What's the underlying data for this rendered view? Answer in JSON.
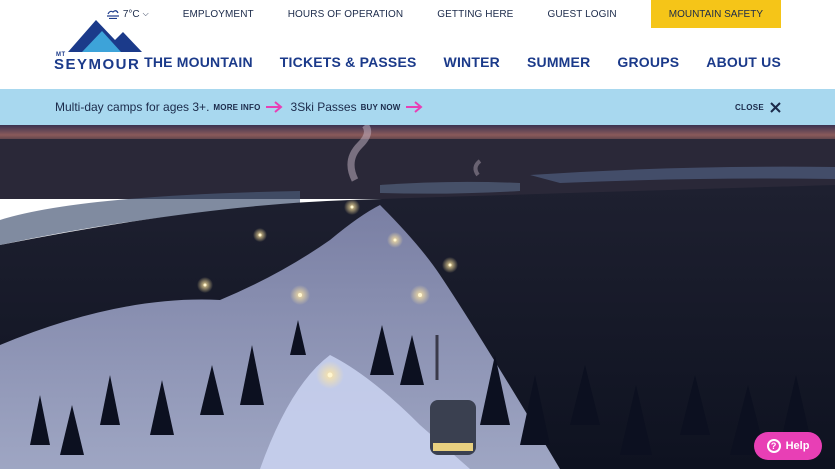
{
  "brand": {
    "prefix": "MT",
    "name": "SEYMOUR",
    "colors": {
      "navy": "#1b3a8a",
      "sky": "#3da3d9"
    }
  },
  "utility_nav": {
    "weather": {
      "icon": "weather-cloud-icon",
      "temp": "7°C"
    },
    "links": [
      "EMPLOYMENT",
      "HOURS OF OPERATION",
      "GETTING HERE",
      "GUEST LOGIN"
    ],
    "safety": {
      "label": "MOUNTAIN SAFETY",
      "color": "#f5c518"
    }
  },
  "main_nav": [
    "THE MOUNTAIN",
    "TICKETS & PASSES",
    "WINTER",
    "SUMMER",
    "GROUPS",
    "ABOUT US"
  ],
  "promo": {
    "background": "#a8d8ef",
    "items": [
      {
        "text": "Multi-day camps for ages 3+.",
        "cta": "MORE INFO"
      },
      {
        "text": "3Ski Passes",
        "cta": "BUY NOW"
      }
    ],
    "arrow_color": "#e83fb5",
    "close_label": "CLOSE"
  },
  "hero": {
    "scene": "night-ski-mountain-aerial"
  },
  "help_button": {
    "label": "Help",
    "icon": "question-circle-icon",
    "color": "#e83fb5"
  }
}
